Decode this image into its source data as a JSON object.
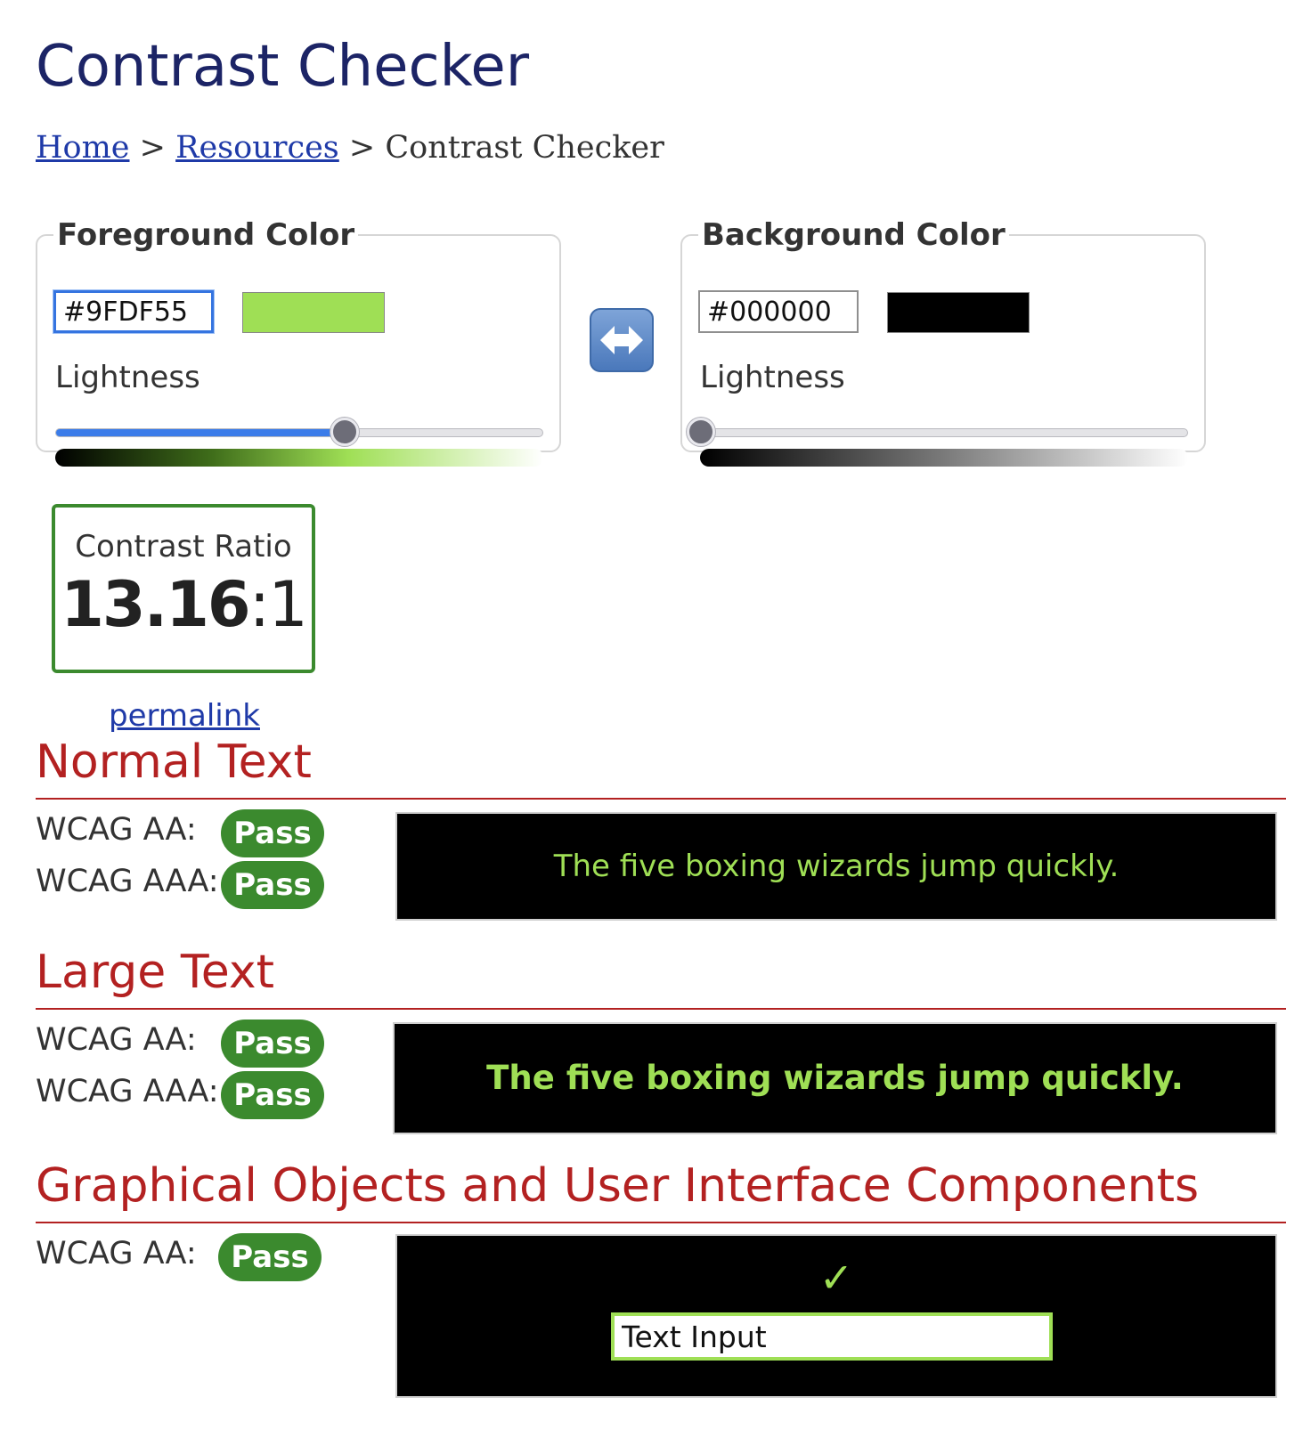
{
  "page": {
    "title": "Contrast Checker"
  },
  "breadcrumb": {
    "items": [
      "Home",
      "Resources",
      "Contrast Checker"
    ],
    "separator": ">"
  },
  "foreground": {
    "legend": "Foreground Color",
    "hex_value": "#9FDF55",
    "swatch_color": "#9FDF55",
    "lightness_label": "Lightness",
    "lightness_fraction": 0.593
  },
  "background": {
    "legend": "Background Color",
    "hex_value": "#000000",
    "swatch_color": "#000000",
    "lightness_label": "Lightness",
    "lightness_fraction": 0.0
  },
  "swap": {
    "icon": "left-right-arrow-icon"
  },
  "result": {
    "label": "Contrast Ratio",
    "ratio_number": "13.16",
    "ratio_suffix": ":1",
    "permalink_label": "permalink"
  },
  "colors": {
    "heading_red": "#b32121",
    "pass_green": "#3b8a2e",
    "link_blue": "#1f3aa8",
    "title_navy": "#1c2466"
  },
  "sections": {
    "normal": {
      "heading": "Normal Text",
      "aa_label": "WCAG AA:",
      "aa_result": "Pass",
      "aaa_label": "WCAG AAA:",
      "aaa_result": "Pass",
      "sample_text": "The five boxing wizards jump quickly."
    },
    "large": {
      "heading": "Large Text",
      "aa_label": "WCAG AA:",
      "aa_result": "Pass",
      "aaa_label": "WCAG AAA:",
      "aaa_result": "Pass",
      "sample_text": "The five boxing wizards jump quickly."
    },
    "graphical": {
      "heading": "Graphical Objects and User Interface Components",
      "aa_label": "WCAG AA:",
      "aa_result": "Pass",
      "check_icon": "checkmark-icon",
      "input_value": "Text Input"
    }
  }
}
